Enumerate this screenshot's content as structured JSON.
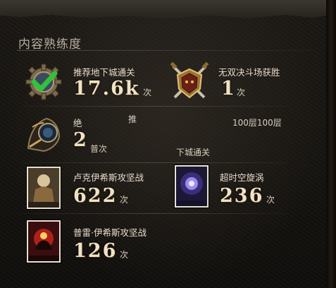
{
  "panel": {
    "title": "内容熟练度"
  },
  "entries": [
    {
      "label": "推荐地下城通关",
      "value": "17.6k",
      "unit": "次",
      "icon": "gear-checkmark-icon"
    },
    {
      "label": "无双决斗场获胜",
      "value": "1",
      "unit": "次",
      "icon": "crossed-swords-shield-icon"
    },
    {
      "label": "绝",
      "value": "2",
      "unit": "普次",
      "icon": "hooded-figure-icon"
    },
    {
      "label": "卢克伊希斯攻坚战",
      "value": "622",
      "unit": "次",
      "icon": "luke-portrait-icon"
    },
    {
      "label": "超时空旋涡",
      "value": "236",
      "unit": "次",
      "icon": "vortex-portrait-icon"
    },
    {
      "label": "普雷·伊希斯攻坚战",
      "value": "126",
      "unit": "次",
      "icon": "prey-portrait-icon"
    }
  ],
  "overlay": {
    "mid_text": "推",
    "floor_text": "100层100层",
    "dungeon_text": "下城通关"
  },
  "colors": {
    "accent": "#2fc23a",
    "gold": "#c9a45a",
    "text": "#e8dccb"
  }
}
